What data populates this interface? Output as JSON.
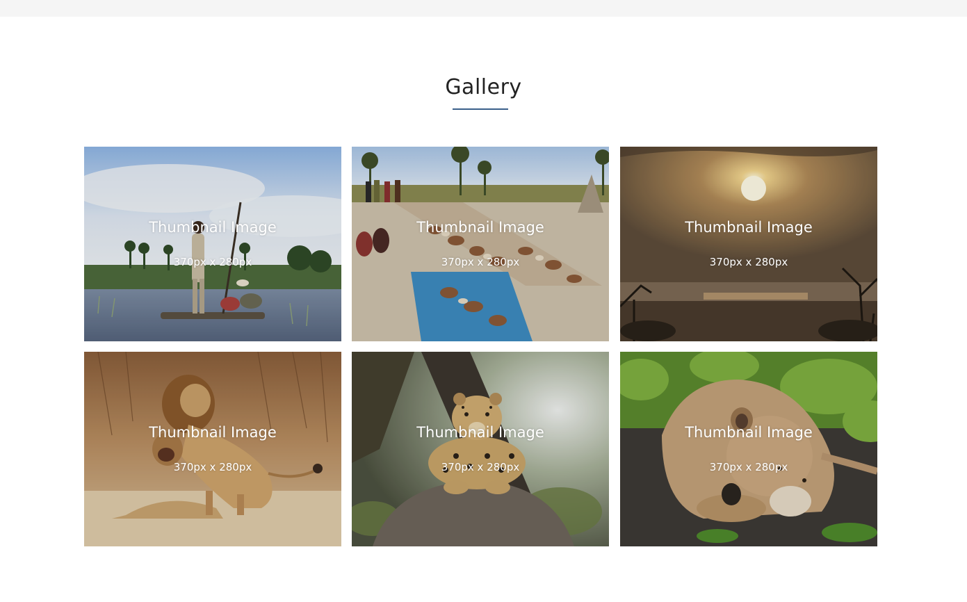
{
  "gallery": {
    "title": "Gallery",
    "accent_color": "#3a5f8a",
    "items": [
      {
        "title": "Thumbnail Image",
        "size": "370px x 280px",
        "scene": "mokoro-canoe-on-river"
      },
      {
        "title": "Thumbnail Image",
        "size": "370px x 280px",
        "scene": "craft-market-baskets"
      },
      {
        "title": "Thumbnail Image",
        "size": "370px x 280px",
        "scene": "sunset-over-savanna"
      },
      {
        "title": "Thumbnail Image",
        "size": "370px x 280px",
        "scene": "lions-in-grass"
      },
      {
        "title": "Thumbnail Image",
        "size": "370px x 280px",
        "scene": "leopard-on-rock"
      },
      {
        "title": "Thumbnail Image",
        "size": "370px x 280px",
        "scene": "resting-lioness"
      }
    ]
  }
}
